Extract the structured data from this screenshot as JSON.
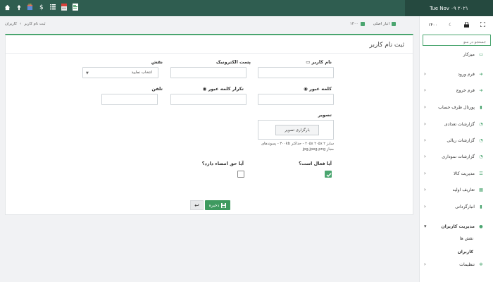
{
  "topbar": {
    "icons": [
      "home-icon",
      "arrow-up-icon",
      "calendar-icon",
      "dollar-icon",
      "list-icon",
      "pdf-icon",
      "report-icon"
    ],
    "date": "Tue Nov ۰۹ ۲۰۲۱"
  },
  "breadcrumb": {
    "items": [
      "کاربران",
      "ثبت نام کاربر"
    ],
    "separator": "›",
    "warehouse": "انبار اصلی",
    "year": "۱۴۰۰"
  },
  "form": {
    "title": "ثبت نام کاربر",
    "username_label": "نام کاربر",
    "email_label": "پست الکترونیک",
    "role_label": "نقش",
    "role_select_value": "انتخاب نمایید",
    "password_label": "کلمه عبور",
    "password_repeat_label": "تکرار کلمه عبور",
    "phone_label": "تلفن",
    "image_label": "تصویر",
    "upload_button": "بارگزاری تصویر",
    "upload_hint": "سایز ۲۰۵x ۲۰۵x ۲ - حداکثر ۳۰۰kb - پسوندهای مجاز jpg,jpeg,png",
    "active_label": "آیا فعال است؟",
    "active_checked": true,
    "sign_label": "آیا حق امضاء دارد؟",
    "sign_checked": false,
    "save_button": "ذخیره"
  },
  "sidebar": {
    "tools": [
      "expand-icon",
      "lock-icon",
      "moon-icon",
      "۱۴۰۰"
    ],
    "search_placeholder": "جستجو در منو",
    "items": [
      {
        "label": "میزکار",
        "icon": "monitor-icon",
        "chevron": false
      },
      {
        "label": "فرم ورود",
        "icon": "enter-icon",
        "chevron": true
      },
      {
        "label": "فرم خروج",
        "icon": "exit-icon",
        "chevron": true
      },
      {
        "label": "پورتال طرف حساب",
        "icon": "file-icon",
        "chevron": true
      },
      {
        "label": "گزارشات تعدادی",
        "icon": "chart-icon",
        "chevron": true
      },
      {
        "label": "گزارشات ریالی",
        "icon": "chart-icon",
        "chevron": true
      },
      {
        "label": "گزارشات نموداری",
        "icon": "chart-icon",
        "chevron": true
      },
      {
        "label": "مدیریت کالا",
        "icon": "list-icon",
        "chevron": true
      },
      {
        "label": "تعاریف اولیه",
        "icon": "table-icon",
        "chevron": true
      },
      {
        "label": "انبارگردانی",
        "icon": "file-icon",
        "chevron": true
      },
      {
        "label": "مدیریت کاربران",
        "icon": "user-icon",
        "chevron": true,
        "open": true
      },
      {
        "label": "تنظیمات",
        "icon": "gears-icon",
        "chevron": true
      }
    ],
    "subitems": [
      {
        "label": "نقش ها",
        "active": false
      },
      {
        "label": "کاربران",
        "active": true
      }
    ]
  },
  "colors": {
    "topbar": "#2f5d50",
    "accent": "#4aa56f",
    "save": "#3e9a5f"
  }
}
